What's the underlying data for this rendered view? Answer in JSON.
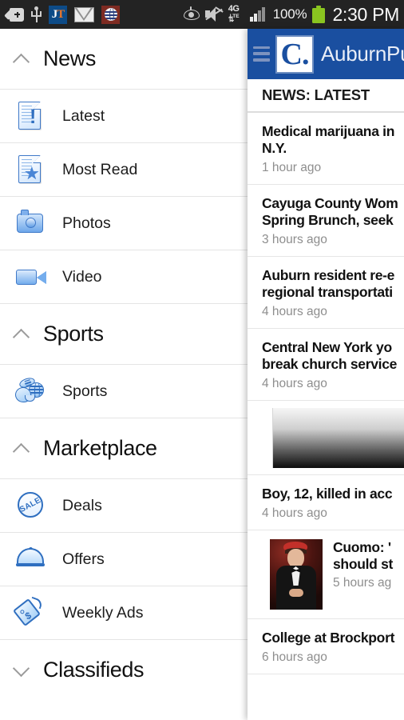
{
  "status_bar": {
    "icons_left": [
      "back-plus-icon",
      "usb-icon",
      "jt-app-icon",
      "gmail-icon",
      "globe-app-icon"
    ],
    "jt_label_j": "J",
    "jt_label_t": "T",
    "icons_right": [
      "eye-icon",
      "mute-icon",
      "4g-lte-icon",
      "signal-icon"
    ],
    "network_label": "4G",
    "network_sub": "LTE",
    "battery_percent": "100%",
    "time": "2:30 PM"
  },
  "sidebar": {
    "sections": [
      {
        "title": "News",
        "expanded": true,
        "chevron": "chevron-up-icon",
        "items": [
          {
            "label": "Latest",
            "icon": "document-alert-icon"
          },
          {
            "label": "Most Read",
            "icon": "document-star-icon"
          },
          {
            "label": "Photos",
            "icon": "camera-icon"
          },
          {
            "label": "Video",
            "icon": "video-camera-icon"
          }
        ]
      },
      {
        "title": "Sports",
        "expanded": true,
        "chevron": "chevron-up-icon",
        "items": [
          {
            "label": "Sports",
            "icon": "sports-balls-icon"
          }
        ]
      },
      {
        "title": "Marketplace",
        "expanded": true,
        "chevron": "chevron-up-icon",
        "items": [
          {
            "label": "Deals",
            "icon": "sale-badge-icon"
          },
          {
            "label": "Offers",
            "icon": "cloche-dome-icon"
          },
          {
            "label": "Weekly Ads",
            "icon": "price-tag-icon"
          }
        ]
      },
      {
        "title": "Classifieds",
        "expanded": false,
        "chevron": "chevron-down-icon",
        "items": []
      }
    ]
  },
  "content": {
    "app_bar": {
      "menu_icon": "hamburger-menu-icon",
      "logo_letter": "C.",
      "title": "AuburnPub"
    },
    "section_label": "NEWS: LATEST",
    "articles": [
      {
        "headline_lines": [
          "Medical marijuana in",
          "N.Y."
        ],
        "timestamp": "1 hour ago",
        "has_thumb": false
      },
      {
        "headline_lines": [
          "Cayuga County Wom",
          "Spring Brunch, seek"
        ],
        "timestamp": "3 hours ago",
        "has_thumb": false
      },
      {
        "headline_lines": [
          "Auburn resident re-e",
          "regional transportati"
        ],
        "timestamp": "4 hours ago",
        "has_thumb": false
      },
      {
        "headline_lines": [
          "Central New York yo",
          "break church service"
        ],
        "timestamp": "4 hours ago",
        "has_thumb": false
      },
      {
        "headline_lines": [
          "Boy, 12, killed in acc"
        ],
        "timestamp": "4 hours ago",
        "has_thumb": false
      },
      {
        "headline_lines": [
          "Cuomo: '",
          "should st"
        ],
        "timestamp": "5 hours ag",
        "has_thumb": true,
        "thumb": "tuxedo-man-photo"
      },
      {
        "headline_lines": [
          "College at Brockport"
        ],
        "timestamp": "6 hours ago",
        "has_thumb": false
      }
    ],
    "ad_banner": "gradient-ad-banner"
  },
  "colors": {
    "status_bar_bg": "#232323",
    "app_bar_blue": "#1a4fa0",
    "icon_blue": "#2f6fc0",
    "text_dark": "#111111",
    "timestamp_gray": "#8e8e8e",
    "battery_green": "#8ac520"
  }
}
